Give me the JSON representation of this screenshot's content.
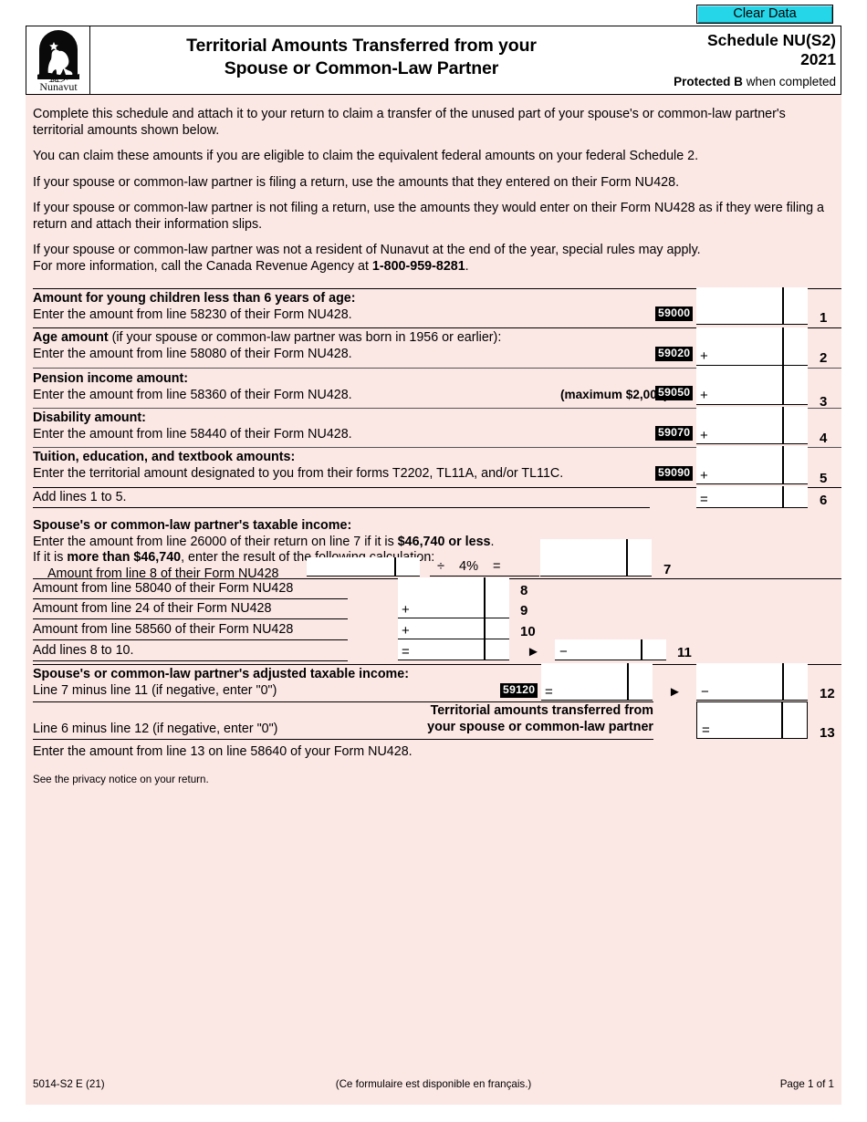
{
  "toolbar": {
    "clear_data_label": "Clear Data"
  },
  "header": {
    "logo_name": "Nunavut",
    "logo_syllabics": "ᓄᓇᕗᑦ",
    "title_line1": "Territorial Amounts Transferred from your",
    "title_line2": "Spouse or Common-Law Partner",
    "schedule_name": "Schedule NU(S2)",
    "year": "2021",
    "protected_bold": "Protected B",
    "protected_rest": " when completed"
  },
  "intro": {
    "p1": "Complete this schedule and attach it to your return to claim a transfer of the unused part of your spouse's or common-law partner's territorial amounts shown below.",
    "p2": "You can claim these amounts if you are eligible to claim the equivalent federal amounts on your federal Schedule 2.",
    "p3": "If your spouse or common-law partner is filing a return, use the amounts that they entered on their Form NU428.",
    "p4": "If your spouse or common-law partner is not filing a return, use the amounts they would enter on their Form NU428 as if they were filing a return and attach their information slips.",
    "p5a": "If your spouse or common-law partner was not a resident of Nunavut at the end of the year, special rules may apply.",
    "p5b": "For more information, call the Canada Revenue Agency at ",
    "p5_phone": "1-800-959-8281",
    "p5c": "."
  },
  "lines": {
    "l1": {
      "heading": "Amount for young children less than 6 years of age:",
      "text": "Enter the amount from line 58230 of their Form NU428.",
      "code": "59000",
      "op": "",
      "value": "",
      "num": "1"
    },
    "l2": {
      "heading_bold": "Age amount",
      "heading_rest": " (if your spouse or common-law partner was born in 1956 or earlier):",
      "text": "Enter the amount from line 58080 of their Form NU428.",
      "code": "59020",
      "op": "+",
      "value": "",
      "num": "2"
    },
    "l3": {
      "heading": "Pension income amount:",
      "text": "Enter the amount from line 58360 of their Form NU428.",
      "note": "(maximum $2,000)",
      "code": "59050",
      "op": "+",
      "value": "",
      "num": "3"
    },
    "l4": {
      "heading": "Disability amount:",
      "text": "Enter the amount from line 58440 of their Form NU428.",
      "code": "59070",
      "op": "+",
      "value": "",
      "num": "4"
    },
    "l5": {
      "heading": "Tuition, education, and textbook amounts:",
      "text": "Enter the territorial amount designated to you from their forms T2202, TL11A, and/or TL11C.",
      "code": "59090",
      "op": "+",
      "value": "",
      "num": "5"
    },
    "l6": {
      "text": "Add lines 1 to 5.",
      "op": "=",
      "value": "",
      "num": "6"
    },
    "l7": {
      "heading": "Spouse's or common-law partner's taxable income:",
      "text_a": "Enter the amount from line 26000 of their return on line 7 if it is ",
      "text_a_bold": "$46,740 or less",
      "text_a_end": ".",
      "text_b_start": "If it is ",
      "text_b_bold": "more than $46,740",
      "text_b_end": ", enter the result of the following calculation:",
      "sub_text": "Amount from line 8 of their Form NU428",
      "sub_value": "",
      "divide": "÷",
      "percent": "4%",
      "equals": "=",
      "value": "",
      "num": "7"
    },
    "l8": {
      "text": "Amount from line 58040 of their Form NU428",
      "op": "",
      "value": "",
      "num": "8"
    },
    "l9": {
      "text": "Amount from line 24 of their Form NU428",
      "op": "+",
      "value": "",
      "num": "9"
    },
    "l10": {
      "text": "Amount from line 58560 of their Form NU428",
      "op": "+",
      "value": "",
      "num": "10"
    },
    "l11": {
      "text": "Add lines 8 to 10.",
      "op": "=",
      "value": "",
      "arrow": "►",
      "op2": "−",
      "value2": "",
      "num": "11"
    },
    "l12": {
      "heading": "Spouse's or common-law partner's adjusted taxable income:",
      "text": "Line 7 minus line 11 (if negative, enter \"0\")",
      "code": "59120",
      "op": "=",
      "value": "",
      "arrow": "►",
      "op2": "−",
      "value2": "",
      "num": "12"
    },
    "l13": {
      "text": "Line 6 minus line 12 (if negative, enter \"0\")",
      "right_label_1": "Territorial amounts transferred from",
      "right_label_2": "your spouse or common-law partner",
      "op": "=",
      "value": "",
      "num": "13"
    },
    "closing": "Enter the amount from line 13 on line 58640 of your Form NU428."
  },
  "privacy": "See the privacy notice on your return.",
  "footer": {
    "left": "5014-S2 E (21)",
    "center": "(Ce formulaire est disponible en français.)",
    "right": "Page 1 of 1"
  },
  "colors": {
    "page_bg": "#fbe7e4",
    "clear_btn": "#24d6e8"
  }
}
